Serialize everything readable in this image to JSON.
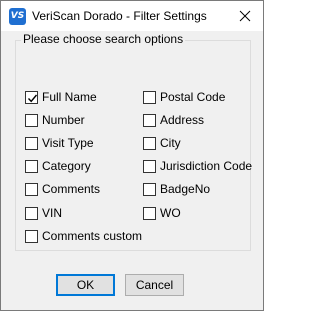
{
  "window": {
    "title": "VeriScan Dorado - Filter Settings",
    "icon_text": "VS",
    "close_icon": "close-icon"
  },
  "group": {
    "legend": "Please choose search options"
  },
  "options": [
    {
      "label": "Full Name",
      "checked": true
    },
    {
      "label": "Postal Code",
      "checked": false
    },
    {
      "label": "Number",
      "checked": false
    },
    {
      "label": "Address",
      "checked": false
    },
    {
      "label": "Visit Type",
      "checked": false
    },
    {
      "label": "City",
      "checked": false
    },
    {
      "label": "Category",
      "checked": false
    },
    {
      "label": "Jurisdiction Code",
      "checked": false
    },
    {
      "label": "Comments",
      "checked": false
    },
    {
      "label": "BadgeNo",
      "checked": false
    },
    {
      "label": "VIN",
      "checked": false
    },
    {
      "label": "WO",
      "checked": false
    },
    {
      "label": "Comments custom",
      "checked": false
    }
  ],
  "buttons": {
    "ok_label": "OK",
    "cancel_label": "Cancel"
  },
  "colors": {
    "accent": "#0078d7",
    "icon_bg": "#1f6fd1"
  }
}
